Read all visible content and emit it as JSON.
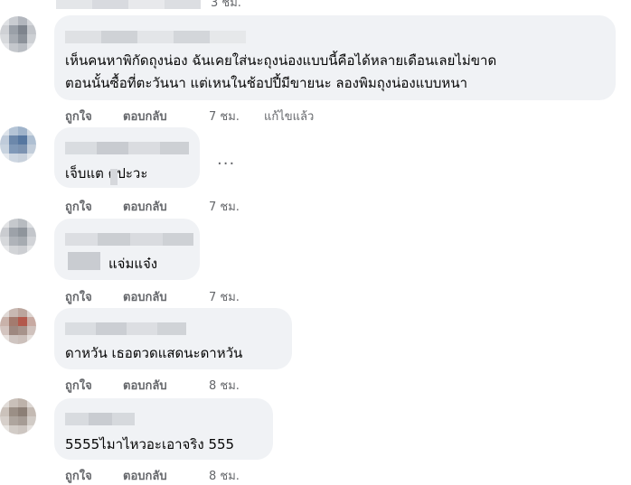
{
  "comments": [
    {
      "text_lines": [],
      "time": "3 ชม."
    },
    {
      "text_lines": [
        "เห็นคนหาพิกัดถุงน่อง ฉันเคยใส่นะถุงน่องแบบนี้คือได้หลายเดือนเลยไม่ขาด",
        "ตอนนั้นซื้อที่ตะวันนา แต่เหนในช้อปปี้มีขายนะ ลองพิมถุงน่องแบบหนา"
      ],
      "like": "ถูกใจ",
      "reply": "ตอบกลับ",
      "time": "7 ชม.",
      "edited": "แก้ไขแล้ว"
    },
    {
      "text_lines": [
        "เจ็บแต ดปะวะ"
      ],
      "like": "ถูกใจ",
      "reply": "ตอบกลับ",
      "time": "7 ชม.",
      "more": "..."
    },
    {
      "text_lines": [
        "แจ่มแจ๋ง"
      ],
      "like": "ถูกใจ",
      "reply": "ตอบกลับ",
      "time": "7 ชม."
    },
    {
      "text_lines": [
        "ดาหวัน เธอตวดแสดนะดาหวัน"
      ],
      "like": "ถูกใจ",
      "reply": "ตอบกลับ",
      "time": "8 ชม."
    },
    {
      "text_lines": [
        "5555ไมาไหวอะเอาจริง 555"
      ],
      "like": "ถูกใจ",
      "reply": "ตอบกลับ",
      "time": "8 ชม."
    }
  ],
  "colors": {
    "bubble": "#f0f2f5",
    "meta": "#65676b",
    "text": "#050505"
  }
}
